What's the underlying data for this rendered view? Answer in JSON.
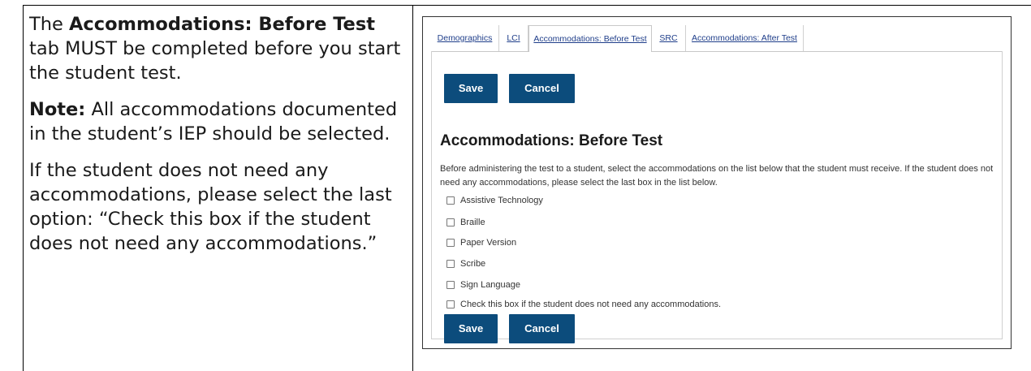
{
  "instructions": {
    "p1": {
      "pre": "The ",
      "bold": "Accommodations: Before Test",
      "post": " tab MUST be completed before you start the student test."
    },
    "p2": {
      "bold": "Note:",
      "post": " All accommodations documented in the student’s IEP should be selected."
    },
    "p3": {
      "text": "If the student does not need any accommodations, please select the last option: “Check this box if the student does not need any accommodations.”"
    }
  },
  "tabs": [
    {
      "label": "Demographics"
    },
    {
      "label": "LCI"
    },
    {
      "label": "Accommodations: Before Test",
      "active": true
    },
    {
      "label": "SRC"
    },
    {
      "label": "Accommodations: After Test"
    }
  ],
  "buttons": {
    "save": "Save",
    "cancel": "Cancel"
  },
  "section": {
    "title": "Accommodations: Before Test",
    "description": "Before administering the test to a student, select the accommodations on the list below that the student must receive. If the student does not need any accommodations, please select the last box in the list below."
  },
  "options": [
    "Assistive Technology",
    "Braille",
    "Paper Version",
    "Scribe",
    "Sign Language",
    "Check this box if the student does not need any accommodations."
  ]
}
